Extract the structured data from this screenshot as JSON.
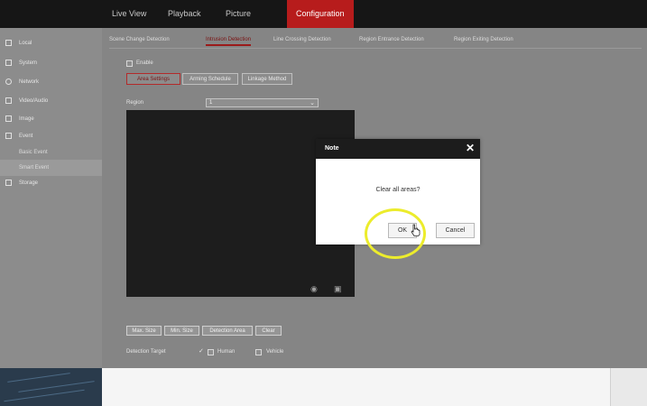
{
  "nav": {
    "items": [
      {
        "label": "Live View",
        "active": false
      },
      {
        "label": "Playback",
        "active": false
      },
      {
        "label": "Picture",
        "active": false
      },
      {
        "label": "Configuration",
        "active": true
      }
    ]
  },
  "sidebar": {
    "items": [
      {
        "label": "Local",
        "icon": "monitor-icon",
        "sub": false
      },
      {
        "label": "System",
        "icon": "system-icon",
        "sub": false
      },
      {
        "label": "Network",
        "icon": "network-icon",
        "sub": false
      },
      {
        "label": "Video/Audio",
        "icon": "video-audio-icon",
        "sub": false
      },
      {
        "label": "Image",
        "icon": "image-icon",
        "sub": false
      },
      {
        "label": "Event",
        "icon": "event-icon",
        "sub": false
      },
      {
        "label": "Basic Event",
        "icon": "",
        "sub": true
      },
      {
        "label": "Smart Event",
        "icon": "",
        "sub": true,
        "active": true
      },
      {
        "label": "Storage",
        "icon": "storage-icon",
        "sub": false
      }
    ]
  },
  "tabs": [
    {
      "label": "Scene Change Detection",
      "active": false
    },
    {
      "label": "Intrusion Detection",
      "active": true
    },
    {
      "label": "Line Crossing Detection",
      "active": false
    },
    {
      "label": "Region Entrance Detection",
      "active": false
    },
    {
      "label": "Region Exiting Detection",
      "active": false
    }
  ],
  "enable_label": "Enable",
  "subtabs": [
    {
      "label": "Area Settings",
      "active": true
    },
    {
      "label": "Arming Schedule",
      "active": false
    },
    {
      "label": "Linkage Method",
      "active": false
    }
  ],
  "region": {
    "label": "Region",
    "value": "1"
  },
  "area_buttons": [
    "Max. Size",
    "Min. Size",
    "Detection Area",
    "Clear"
  ],
  "detection_target": {
    "label": "Detection Target",
    "options": [
      {
        "label": "Human",
        "checked": true
      },
      {
        "label": "Vehicle",
        "checked": false
      }
    ]
  },
  "dialog": {
    "title": "Note",
    "message": "Clear all areas?",
    "ok_label": "OK",
    "cancel_label": "Cancel"
  },
  "colors": {
    "accent": "#b71c1c",
    "highlight": "#ecec2c"
  }
}
